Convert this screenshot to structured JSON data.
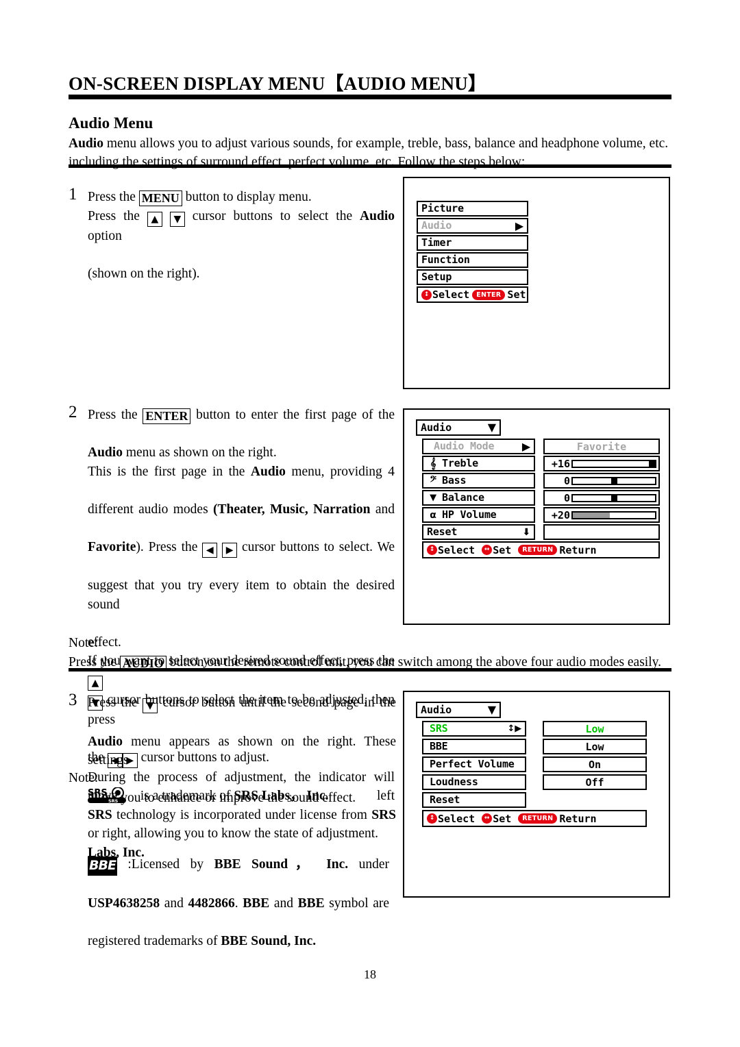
{
  "document": {
    "chapter_title": "ON-SCREEN DISPLAY MENU【AUDIO MENU】",
    "section_title": "Audio Menu",
    "intro_line1_bold": "Audio",
    "intro_line1_rest": " menu allows you to adjust various sounds, for example, treble, bass, balance and headphone volume, etc.",
    "intro_line2": "including the settings of surround effect, perfect volume, etc. Follow the steps below:",
    "page_number": "18"
  },
  "steps": {
    "step1": {
      "number": "1",
      "l1_a": "Press the ",
      "l1_key": "MENU",
      "l1_b": " button to display menu.",
      "l2_a": "Press the ",
      "l2_key1": "▲",
      "l2_key2": "▼",
      "l2_b": " cursor buttons to select the ",
      "l2_bold": "Audio",
      "l2_c": " option",
      "l3": "(shown on the right)."
    },
    "step2": {
      "number": "2",
      "l1_a": "Press the ",
      "l1_key": "ENTER",
      "l1_b": " button to enter the first page of the",
      "l2_bold": "Audio",
      "l2_rest": " menu as shown on the right.",
      "l3_a": "This is the first page in the ",
      "l3_bold": "Audio",
      "l3_b": " menu, providing 4",
      "l4_a": "different audio modes ",
      "l4_bold": "(Theater, Music, Narration",
      "l4_b": " and",
      "l5_bold": "Favorite",
      "l5_a": "). Press the ",
      "l5_key1": "◀",
      "l5_key2": "▶",
      "l5_b": " cursor buttons to select. We",
      "l6": "suggest that you try every item to obtain the desired sound",
      "l7": "effect.",
      "l8_a": "If you want to select your desired sound effect, press the ",
      "l8_key": "▲",
      "l9_key": "▼",
      "l9_a": " cursor buttons to select the item to be adjusted, then press",
      "l10_a": "the ",
      "l10_key1": "◀",
      "l10_key2": "▶",
      "l10_b": " cursor buttons to adjust.",
      "l11": "During the process of adjustment, the indicator will move left",
      "l12": "or right, allowing you to know the state of adjustment."
    },
    "note1": {
      "label": "Note:",
      "a": "Press the ",
      "key": "AUDIO",
      "b": " button on the remote control unit, you can switch among the above four audio modes easily."
    },
    "step3": {
      "number": "3",
      "l1_a": "Press the ",
      "l1_key": "▼",
      "l1_b": " cursor button until the second page in the",
      "l2_bold": "Audio",
      "l2_rest": " menu appears as shown on the right. These settings",
      "l3": "allow you to enhance or improve the sound effect."
    },
    "note2": {
      "label": "Note:",
      "srs_logo_name": "srs-logo",
      "srs_line1": " is a trademark of ",
      "srs_line1_bold": "SRS Labs， Inc.",
      "srs_line2_bold1": "SRS",
      "srs_line2_mid": " technology is incorporated under license from ",
      "srs_line2_bold2": "SRS",
      "srs_line3_bold": "Labs, Inc.",
      "bbe_logo_text": "BBE",
      "bbe_line1_a": " :Licensed   by   ",
      "bbe_line1_bold": "BBE   Sound，  Inc.",
      "bbe_line1_b": "   under",
      "bbe_line2_bold1": "USP4638258",
      "bbe_line2_mid1": " and ",
      "bbe_line2_bold2": "4482866",
      "bbe_line2_mid2": ". ",
      "bbe_line2_bold3": "BBE",
      "bbe_line2_mid3": " and ",
      "bbe_line2_bold4": "BBE",
      "bbe_line2_end": " symbol are",
      "bbe_line3_a": "registered trademarks of ",
      "bbe_line3_bold": "BBE Sound, Inc."
    }
  },
  "osd": {
    "main_menu": {
      "items": [
        {
          "label": "Picture",
          "state": "normal",
          "caret": ""
        },
        {
          "label": "Audio",
          "state": "dim",
          "caret": "▶"
        },
        {
          "label": "Timer",
          "state": "normal",
          "caret": ""
        },
        {
          "label": "Function",
          "state": "normal",
          "caret": ""
        },
        {
          "label": "Setup",
          "state": "normal",
          "caret": ""
        }
      ],
      "hint": {
        "select_icon": "updown-arrow-icon",
        "select_label": "Select",
        "set_key": "ENTER",
        "set_label": "Set"
      }
    },
    "audio_page1": {
      "title": "Audio",
      "title_caret": "▼",
      "rows": [
        {
          "icon": "",
          "label": "Audio Mode",
          "caret": "▶",
          "state": "dim",
          "value_type": "text",
          "value": "Favorite",
          "value_state": "dim"
        },
        {
          "icon": "treble-clef-icon",
          "label": "Treble",
          "caret": "",
          "state": "normal",
          "value_type": "slider",
          "value": "+16",
          "fill_percent": 0,
          "knob_percent": 100,
          "knob_style": "knob"
        },
        {
          "icon": "bass-clef-icon",
          "label": "Bass",
          "caret": "",
          "state": "normal",
          "value_type": "slider",
          "value": "0",
          "fill_percent": 0,
          "knob_percent": 50,
          "knob_style": "knob"
        },
        {
          "icon": "balance-icon",
          "label": "Balance",
          "caret": "",
          "state": "normal",
          "value_type": "slider",
          "value": "0",
          "fill_percent": 0,
          "knob_percent": 50,
          "knob_style": "knob"
        },
        {
          "icon": "headphone-icon",
          "label": "HP Volume",
          "caret": "",
          "state": "normal",
          "value_type": "slider",
          "value": "+20",
          "fill_percent": 45,
          "knob_percent": 0,
          "knob_style": "fill"
        },
        {
          "icon": "",
          "label": "Reset",
          "caret": "⬇",
          "state": "normal",
          "value_type": "blank",
          "value": ""
        }
      ],
      "hint": {
        "select_icon": "updown-arrow-icon",
        "select_label": "Select",
        "set_icon": "leftright-arrow-icon",
        "set_label": "Set",
        "return_key": "RETURN",
        "return_label": "Return"
      }
    },
    "audio_page2": {
      "title": "Audio",
      "title_caret": "▼",
      "rows": [
        {
          "label": "SRS",
          "caret": "↕▶",
          "state": "green",
          "value": "Low",
          "value_state": "green"
        },
        {
          "label": "BBE",
          "caret": "",
          "state": "normal",
          "value": "Low",
          "value_state": "normal"
        },
        {
          "label": "Perfect Volume",
          "caret": "",
          "state": "normal",
          "value": "On",
          "value_state": "normal"
        },
        {
          "label": "Loudness",
          "caret": "",
          "state": "normal",
          "value": "Off",
          "value_state": "normal"
        },
        {
          "label": "Reset",
          "caret": "",
          "state": "normal",
          "value": "",
          "value_state": "none"
        }
      ],
      "hint": {
        "select_icon": "updown-arrow-icon",
        "select_label": "Select",
        "set_icon": "leftright-arrow-icon",
        "set_label": "Set",
        "return_key": "RETURN",
        "return_label": "Return"
      }
    }
  },
  "colors": {
    "accent_red": "#e30613",
    "osd_green": "#00c000",
    "dim_gray": "#a6a6a6"
  }
}
